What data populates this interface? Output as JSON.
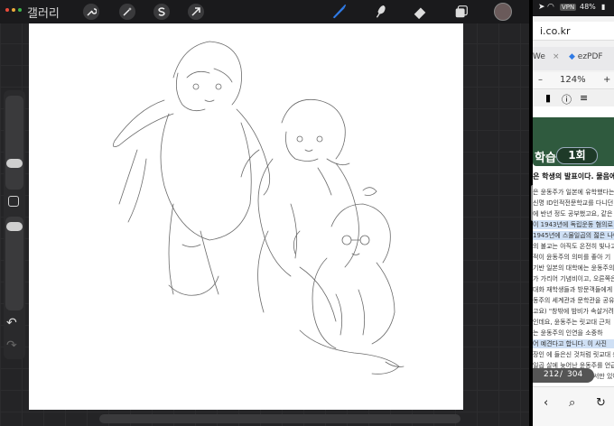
{
  "procreate": {
    "gallery_label": "갤러리",
    "traffic_dots": [
      "#e94b3c",
      "#e9a93c",
      "#3cb44b"
    ],
    "tools_left": [
      "wrench-icon",
      "magic-wand-icon",
      "selection-s-icon",
      "transform-arrow-icon"
    ],
    "tools_right": [
      "brush-icon",
      "smudge-icon",
      "eraser-icon",
      "layers-icon"
    ],
    "accent": "#2f7ae5",
    "brush_size_level": 0.25,
    "brush_opacity_level": 0.95,
    "undo_icon": "undo-icon",
    "redo_icon": "redo-icon"
  },
  "status_bar": {
    "wifi": "wifi-icon",
    "vpn": "VPN",
    "battery": "48%"
  },
  "browser": {
    "url_fragment": "i.co.kr",
    "tabs": [
      {
        "label": "We",
        "icon": "close-icon"
      },
      {
        "label": "ezPDF",
        "icon": "pdf-app-icon"
      }
    ],
    "zoom": "124%",
    "zoom_minus": "–",
    "zoom_plus": "+",
    "lesson_label": "학습",
    "lesson_badge": "1회",
    "question": "은 학생의 발표이다. 물음에 답",
    "doc_lines": [
      "은 윤동주가 일본에 유학했다는",
      "신명 ID인적전문학교를 다니던 윤동주",
      "에 반년 정도 공부했고요, 같은",
      "이 1943년에 독립운동 혐의로",
      "1945년에 스물일곱의 젊은 나이로 옥사",
      "의 불교는 아직도 온전히 빛나고 있",
      "적이 윤동주의 의미를 좋아 기",
      "기반 일본의 대학에는 윤동주의",
      "가 가리어 기념비이고, 오른쪽은 교",
      "대화 재학생들과 방문객들에게",
      "동주의 세계관과 문학관을 공유하",
      "고요) \"창밖에 밤비가 속살거려",
      "인데요, 윤동주는 릿교대 근처",
      "는 윤동주의 인연을 소중하",
      "어 예견다고 합니다. 이 사진",
      "장인 에 들은신 것처럼 릿교대 총",
      "일곱 살에 늦어난 윤동주를 언급하면서",
      "게 가교도 움 친할 때에서만 있어"
    ],
    "page_current": "212",
    "page_sep": "/",
    "page_total": "304"
  }
}
